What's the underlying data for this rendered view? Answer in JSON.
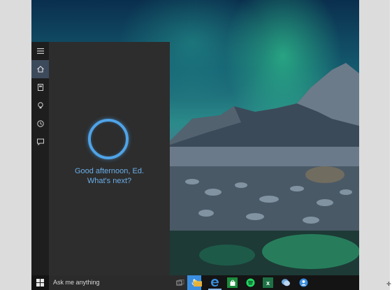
{
  "cortana": {
    "greeting_line1": "Good afternoon, Ed.",
    "greeting_line2": "What's next?",
    "ring_color": "#4fa3e8"
  },
  "sidebar": {
    "items": [
      {
        "name": "menu",
        "icon": "hamburger-icon"
      },
      {
        "name": "home",
        "icon": "home-icon",
        "active": true
      },
      {
        "name": "notebook",
        "icon": "notebook-icon"
      },
      {
        "name": "places",
        "icon": "lightbulb-icon"
      },
      {
        "name": "reminders",
        "icon": "reminder-clock-icon"
      },
      {
        "name": "feedback",
        "icon": "feedback-icon"
      }
    ]
  },
  "taskbar": {
    "search_placeholder": "Ask me anything",
    "accent_color": "#3a8ee0",
    "apps": [
      {
        "name": "task-view",
        "icon": "task-view-icon"
      },
      {
        "name": "file-explorer",
        "icon": "folder-icon"
      },
      {
        "name": "edge",
        "icon": "edge-icon"
      },
      {
        "name": "store",
        "icon": "store-icon"
      },
      {
        "name": "spotify",
        "icon": "spotify-icon"
      },
      {
        "name": "excel",
        "icon": "excel-icon",
        "label": "x"
      },
      {
        "name": "skype",
        "icon": "chat-icon"
      },
      {
        "name": "people",
        "icon": "people-icon"
      }
    ]
  }
}
